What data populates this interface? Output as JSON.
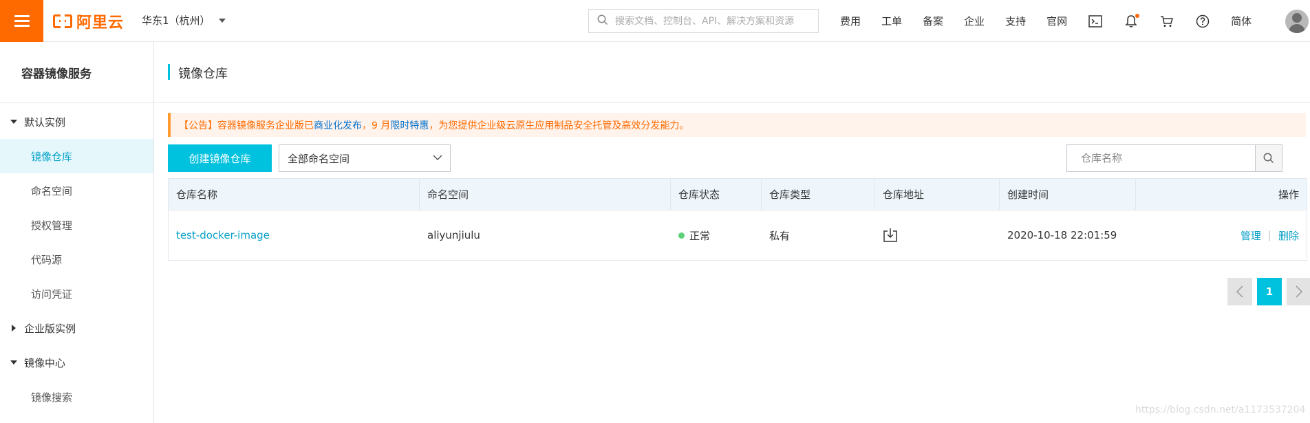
{
  "topbar": {
    "brand": "阿里云",
    "region": "华东1（杭州）",
    "search_placeholder": "搜索文档、控制台、API、解决方案和资源",
    "links": [
      "费用",
      "工单",
      "备案",
      "企业",
      "支持",
      "官网"
    ],
    "language": "简体",
    "icons": [
      "terminal-icon",
      "bell-icon",
      "cart-icon",
      "help-icon"
    ],
    "accent_color": "#ff6a00"
  },
  "sidebar": {
    "title": "容器镜像服务",
    "groups": [
      {
        "label": "默认实例",
        "expanded": true,
        "items": [
          "镜像仓库",
          "命名空间",
          "授权管理",
          "代码源",
          "访问凭证"
        ]
      },
      {
        "label": "企业版实例",
        "expanded": false,
        "items": []
      },
      {
        "label": "镜像中心",
        "expanded": true,
        "items": [
          "镜像搜索"
        ]
      }
    ],
    "active_item": "镜像仓库"
  },
  "main": {
    "page_title": "镜像仓库",
    "notice": {
      "prefix": "【公告】容器镜像服务企业版已",
      "link1": "商业化发布",
      "mid": "，9 月",
      "link2": "限时特惠",
      "suffix": "，为您提供企业级云原生应用制品安全托管及高效分发能力。"
    },
    "create_button": "创建镜像仓库",
    "namespace_select": "全部命名空间",
    "search_placeholder": "仓库名称",
    "table": {
      "columns": [
        "仓库名称",
        "命名空间",
        "仓库状态",
        "仓库类型",
        "仓库地址",
        "创建时间",
        "操作"
      ],
      "rows": [
        {
          "name": "test-docker-image",
          "namespace": "aliyunjiulu",
          "status": "正常",
          "type": "私有",
          "address_icon": "download-icon",
          "created": "2020-10-18 22:01:59",
          "actions": [
            "管理",
            "删除"
          ]
        }
      ]
    },
    "pagination": {
      "current": "1"
    }
  },
  "watermark": "https://blog.csdn.net/a1173537204"
}
